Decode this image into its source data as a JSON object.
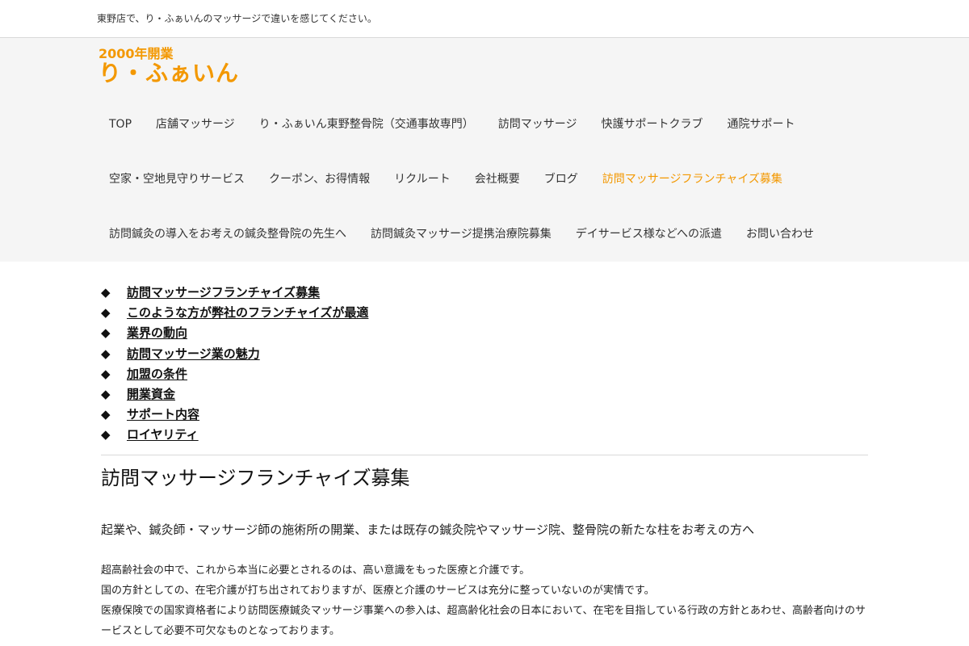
{
  "topbar": {
    "tagline": "東野店で、り・ふぁいんのマッサージで違いを感じてください。"
  },
  "logo": {
    "top": "2000年開業",
    "main": "り・ふぁいん"
  },
  "colors": {
    "accent": "#f39800",
    "header_bg": "#f5f5f5",
    "text": "#222222"
  },
  "nav": {
    "row1": [
      "TOP",
      "店舗マッサージ",
      "り・ふぁいん東野整骨院（交通事故専門）",
      "訪問マッサージ",
      "快護サポートクラブ",
      "通院サポート"
    ],
    "row2": [
      "空家・空地見守りサービス",
      "クーポン、お得情報",
      "リクルート",
      "会社概要",
      "ブログ",
      "訪問マッサージフランチャイズ募集"
    ],
    "row3": [
      "訪問鍼灸の導入をお考えの鍼灸整骨院の先生へ",
      "訪問鍼灸マッサージ提携治療院募集",
      "デイサービス様などへの派遣",
      "お問い合わせ"
    ],
    "active": "訪問マッサージフランチャイズ募集"
  },
  "toc": {
    "bullet": "◆",
    "items": [
      "訪問マッサージフランチャイズ募集",
      "このような方が弊社のフランチャイズが最適",
      "業界の動向",
      "訪問マッサージ業の魅力",
      "加盟の条件",
      "開業資金",
      "サポート内容",
      "ロイヤリティ"
    ]
  },
  "content": {
    "title": "訪問マッサージフランチャイズ募集",
    "lead": "起業や、鍼灸師・マッサージ師の施術所の開業、または既存の鍼灸院やマッサージ院、整骨院の新たな柱をお考えの方へ",
    "paragraphs": [
      "超高齢社会の中で、これから本当に必要とされるのは、高い意識をもった医療と介護です。",
      "国の方針としての、在宅介護が打ち出されておりますが、医療と介護のサービスは充分に整っていないのが実情です。",
      "医療保険での国家資格者により訪問医療鍼灸マッサージ事業への参入は、超高齢化社会の日本において、在宅を目指している行政の方針とあわせ、高齢者向けのサービスとして必要不可欠なものとなっております。"
    ]
  }
}
